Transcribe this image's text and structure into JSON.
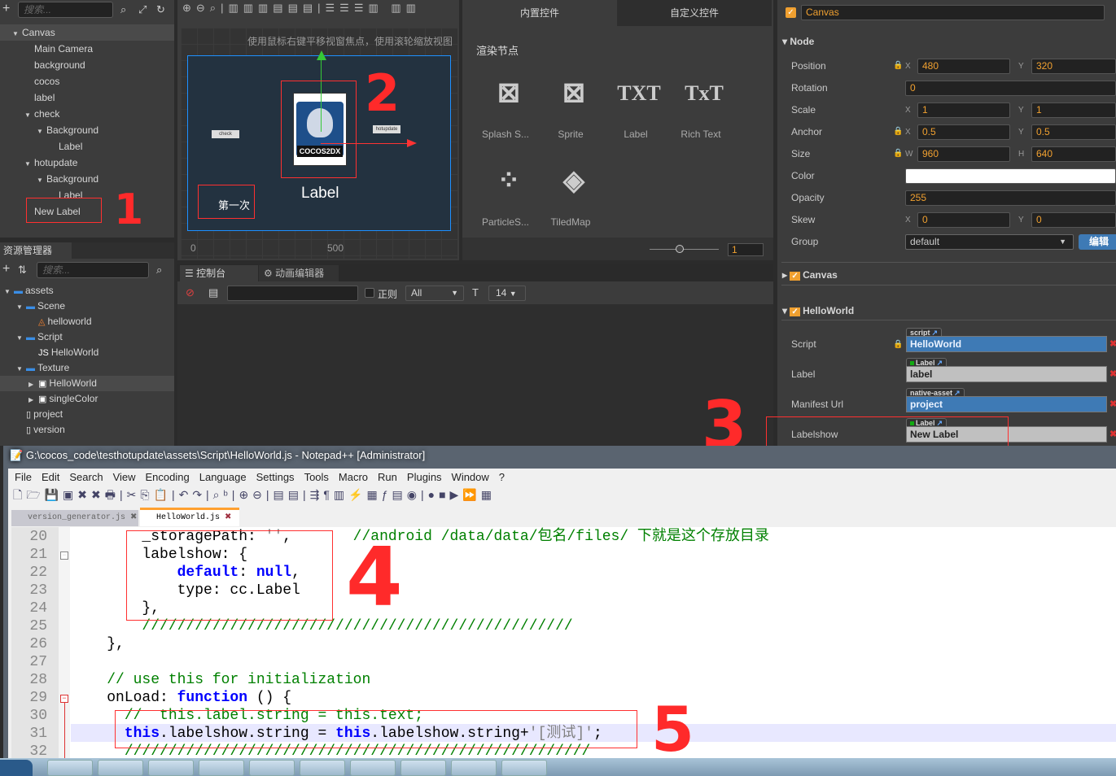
{
  "hierarchy": {
    "search_placeholder": "搜索...",
    "items": [
      {
        "label": "Canvas",
        "level": 0,
        "arrow": true,
        "selected": true
      },
      {
        "label": "Main Camera",
        "level": 1
      },
      {
        "label": "background",
        "level": 1
      },
      {
        "label": "cocos",
        "level": 1
      },
      {
        "label": "label",
        "level": 1
      },
      {
        "label": "check",
        "level": 1,
        "arrow": true
      },
      {
        "label": "Background",
        "level": 2,
        "arrow": true
      },
      {
        "label": "Label",
        "level": 3
      },
      {
        "label": "hotupdate",
        "level": 1,
        "arrow": true
      },
      {
        "label": "Background",
        "level": 2,
        "arrow": true
      },
      {
        "label": "Label",
        "level": 3
      },
      {
        "label": "New Label",
        "level": 1
      }
    ]
  },
  "assets": {
    "title": "资源管理器",
    "search_placeholder": "搜索...",
    "items": [
      {
        "label": "assets",
        "level": 0,
        "arrow": true,
        "icon": "folder-icon"
      },
      {
        "label": "Scene",
        "level": 1,
        "arrow": true,
        "icon": "folder-icon"
      },
      {
        "label": "helloworld",
        "level": 2,
        "icon": "scene-icon"
      },
      {
        "label": "Script",
        "level": 1,
        "arrow": true,
        "icon": "folder-icon"
      },
      {
        "label": "HelloWorld",
        "level": 2,
        "icon": "js-file-icon"
      },
      {
        "label": "Texture",
        "level": 1,
        "arrow": true,
        "icon": "folder-icon"
      },
      {
        "label": "HelloWorld",
        "level": 2,
        "arrow": true,
        "icon": "image-icon",
        "selected": true
      },
      {
        "label": "singleColor",
        "level": 2,
        "arrow": true,
        "icon": "image-icon"
      },
      {
        "label": "project",
        "level": 1,
        "icon": "file-icon"
      },
      {
        "label": "version",
        "level": 1,
        "icon": "file-icon"
      }
    ]
  },
  "scene": {
    "hint": "使用鼠标右键平移视窗焦点，使用滚轮缩放视图",
    "check": "check",
    "hotupdate": "hotupdate",
    "first": "第一次",
    "label": "Label",
    "axis_0": "0",
    "axis_500": "500",
    "logo": "COCOS2DX"
  },
  "widgets": {
    "tabs": [
      "内置控件",
      "自定义控件"
    ],
    "section": "渲染节点",
    "items": [
      "Splash S...",
      "Sprite",
      "Label",
      "Rich Text",
      "ParticleS...",
      "TiledMap"
    ],
    "zoom_value": "1"
  },
  "console": {
    "tabs": [
      "控制台",
      "动画编辑器"
    ],
    "regex_label": "正则",
    "level": "All",
    "font_size": "14"
  },
  "inspector": {
    "node_name": "Canvas",
    "node_section": "Node",
    "position": {
      "label": "Position",
      "x": "480",
      "y": "320"
    },
    "rotation": {
      "label": "Rotation",
      "value": "0"
    },
    "scale": {
      "label": "Scale",
      "x": "1",
      "y": "1"
    },
    "anchor": {
      "label": "Anchor",
      "x": "0.5",
      "y": "0.5"
    },
    "size": {
      "label": "Size",
      "w": "960",
      "h": "640"
    },
    "color": {
      "label": "Color",
      "value": "#ffffff"
    },
    "opacity": {
      "label": "Opacity",
      "value": "255"
    },
    "skew": {
      "label": "Skew",
      "x": "0",
      "y": "0"
    },
    "group": {
      "label": "Group",
      "value": "default",
      "edit": "编辑"
    },
    "canvas_comp": "Canvas",
    "hello_comp": "HelloWorld",
    "props": [
      {
        "label": "Script",
        "tag": "script",
        "value": "HelloWorld",
        "kind": "asset"
      },
      {
        "label": "Label",
        "tag": "Label",
        "value": "label",
        "kind": "node"
      },
      {
        "label": "Manifest Url",
        "tag": "native-asset",
        "value": "project",
        "kind": "asset"
      },
      {
        "label": "Labelshow",
        "tag": "Label",
        "value": "New Label",
        "kind": "node"
      }
    ]
  },
  "npp": {
    "title": "G:\\cocos_code\\testhotupdate\\assets\\Script\\HelloWorld.js - Notepad++ [Administrator]",
    "menu": [
      "File",
      "Edit",
      "Search",
      "View",
      "Encoding",
      "Language",
      "Settings",
      "Tools",
      "Macro",
      "Run",
      "Plugins",
      "Window",
      "?"
    ],
    "tabs": [
      "version_generator.js",
      "HelloWorld.js"
    ],
    "line_numbers": [
      "20",
      "21",
      "22",
      "23",
      "24",
      "25",
      "26",
      "27",
      "28",
      "29",
      "30",
      "31",
      "32"
    ]
  },
  "annotations": [
    "1",
    "2",
    "3",
    "4",
    "5"
  ],
  "colors": {
    "accent": "#ffa030",
    "selection": "#3e7ab5",
    "annotation": "#ff2a2a"
  }
}
